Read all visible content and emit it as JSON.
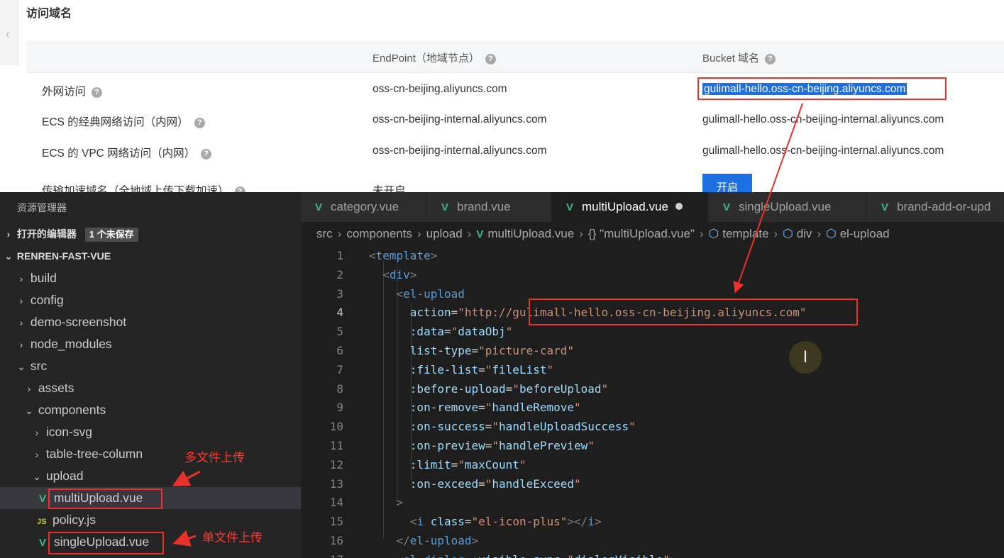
{
  "console": {
    "section_title": "访问域名",
    "collapse_glyph": "‹",
    "help_glyph": "?",
    "headers": {
      "endpoint": "EndPoint（地域节点）",
      "bucket": "Bucket 域名"
    },
    "rows": [
      {
        "label": "外网访问",
        "endpoint": "oss-cn-beijing.aliyuncs.com",
        "bucket": "gulimall-hello.oss-cn-beijing.aliyuncs.com"
      },
      {
        "label": "ECS 的经典网络访问（内网）",
        "endpoint": "oss-cn-beijing-internal.aliyuncs.com",
        "bucket": "gulimall-hello.oss-cn-beijing-internal.aliyuncs.com"
      },
      {
        "label": "ECS 的 VPC 网络访问（内网）",
        "endpoint": "oss-cn-beijing-internal.aliyuncs.com",
        "bucket": "gulimall-hello.oss-cn-beijing-internal.aliyuncs.com"
      },
      {
        "label": "传输加速域名（全地域上传下载加速）",
        "endpoint": "未开启",
        "bucket": ""
      }
    ],
    "open_button": "开启",
    "accent": "#1f70e3"
  },
  "explorer": {
    "title": "资源管理器",
    "open_editors": "打开的编辑器",
    "unsaved_badge": "1 个未保存",
    "project": "RENREN-FAST-VUE",
    "folders": {
      "build": "build",
      "config": "config",
      "demo": "demo-screenshot",
      "node_modules": "node_modules",
      "src": "src",
      "assets": "assets",
      "components": "components",
      "icon_svg": "icon-svg",
      "table_tree": "table-tree-column",
      "upload": "upload"
    },
    "files": {
      "multi": "multiUpload.vue",
      "policy": "policy.js",
      "single": "singleUpload.vue"
    },
    "icons": {
      "vue": "V",
      "js": "JS",
      "chev_right": "›",
      "chev_down": "⌄"
    },
    "annotations": {
      "multi": "多文件上传",
      "single": "单文件上传"
    }
  },
  "editor": {
    "tabs": [
      "category.vue",
      "brand.vue",
      "multiUpload.vue",
      "singleUpload.vue",
      "brand-add-or-upd"
    ],
    "active_tab": "multiUpload.vue",
    "breadcrumb": [
      "src",
      "components",
      "upload",
      "multiUpload.vue",
      "{} \"multiUpload.vue\"",
      "template",
      "div",
      "el-upload"
    ],
    "cursor_glyph": "I",
    "lines": [
      {
        "n": "1",
        "indent": "",
        "parts": [
          [
            "punct",
            "<"
          ],
          [
            "tag",
            "template"
          ],
          [
            "punct",
            ">"
          ]
        ]
      },
      {
        "n": "2",
        "indent": "  ",
        "parts": [
          [
            "punct",
            "<"
          ],
          [
            "tag",
            "div"
          ],
          [
            "punct",
            ">"
          ]
        ]
      },
      {
        "n": "3",
        "indent": "    ",
        "parts": [
          [
            "punct",
            "<"
          ],
          [
            "tag",
            "el-upload"
          ]
        ]
      },
      {
        "n": "4",
        "indent": "      ",
        "parts": [
          [
            "attr",
            "action"
          ],
          [
            "plain",
            "="
          ],
          [
            "str",
            "\"http://gulimall-hello.oss-cn-beijing.aliyuncs.com\""
          ]
        ]
      },
      {
        "n": "5",
        "indent": "      ",
        "parts": [
          [
            "attr",
            ":data"
          ],
          [
            "plain",
            "="
          ],
          [
            "str",
            "\""
          ],
          [
            "attr",
            "dataObj"
          ],
          [
            "str",
            "\""
          ]
        ]
      },
      {
        "n": "6",
        "indent": "      ",
        "parts": [
          [
            "attr",
            "list-type"
          ],
          [
            "plain",
            "="
          ],
          [
            "str",
            "\"picture-card\""
          ]
        ]
      },
      {
        "n": "7",
        "indent": "      ",
        "parts": [
          [
            "attr",
            ":file-list"
          ],
          [
            "plain",
            "="
          ],
          [
            "str",
            "\""
          ],
          [
            "attr",
            "fileList"
          ],
          [
            "str",
            "\""
          ]
        ]
      },
      {
        "n": "8",
        "indent": "      ",
        "parts": [
          [
            "attr",
            ":before-upload"
          ],
          [
            "plain",
            "="
          ],
          [
            "str",
            "\""
          ],
          [
            "attr",
            "beforeUpload"
          ],
          [
            "str",
            "\""
          ]
        ]
      },
      {
        "n": "9",
        "indent": "      ",
        "parts": [
          [
            "attr",
            ":on-remove"
          ],
          [
            "plain",
            "="
          ],
          [
            "str",
            "\""
          ],
          [
            "attr",
            "handleRemove"
          ],
          [
            "str",
            "\""
          ]
        ]
      },
      {
        "n": "10",
        "indent": "      ",
        "parts": [
          [
            "attr",
            ":on-success"
          ],
          [
            "plain",
            "="
          ],
          [
            "str",
            "\""
          ],
          [
            "attr",
            "handleUploadSuccess"
          ],
          [
            "str",
            "\""
          ]
        ]
      },
      {
        "n": "11",
        "indent": "      ",
        "parts": [
          [
            "attr",
            ":on-preview"
          ],
          [
            "plain",
            "="
          ],
          [
            "str",
            "\""
          ],
          [
            "attr",
            "handlePreview"
          ],
          [
            "str",
            "\""
          ]
        ]
      },
      {
        "n": "12",
        "indent": "      ",
        "parts": [
          [
            "attr",
            ":limit"
          ],
          [
            "plain",
            "="
          ],
          [
            "str",
            "\""
          ],
          [
            "attr",
            "maxCount"
          ],
          [
            "str",
            "\""
          ]
        ]
      },
      {
        "n": "13",
        "indent": "      ",
        "parts": [
          [
            "attr",
            ":on-exceed"
          ],
          [
            "plain",
            "="
          ],
          [
            "str",
            "\""
          ],
          [
            "attr",
            "handleExceed"
          ],
          [
            "str",
            "\""
          ]
        ]
      },
      {
        "n": "14",
        "indent": "    ",
        "parts": [
          [
            "punct",
            ">"
          ]
        ]
      },
      {
        "n": "15",
        "indent": "      ",
        "parts": [
          [
            "punct",
            "<"
          ],
          [
            "tag",
            "i"
          ],
          [
            "plain",
            " "
          ],
          [
            "attr",
            "class"
          ],
          [
            "plain",
            "="
          ],
          [
            "str",
            "\"el-icon-plus\""
          ],
          [
            "punct",
            "></"
          ],
          [
            "tag",
            "i"
          ],
          [
            "punct",
            ">"
          ]
        ]
      },
      {
        "n": "16",
        "indent": "    ",
        "parts": [
          [
            "punct",
            "</"
          ],
          [
            "tag",
            "el-upload"
          ],
          [
            "punct",
            ">"
          ]
        ]
      },
      {
        "n": "17",
        "indent": "    ",
        "parts": [
          [
            "punct",
            "<"
          ],
          [
            "tag",
            "el-dialog"
          ],
          [
            "plain",
            " "
          ],
          [
            "attr",
            ":visible.sync"
          ],
          [
            "plain",
            "="
          ],
          [
            "str",
            "\""
          ],
          [
            "attr",
            "dialogVisible"
          ],
          [
            "str",
            "\""
          ],
          [
            "punct",
            ">"
          ]
        ]
      }
    ]
  }
}
